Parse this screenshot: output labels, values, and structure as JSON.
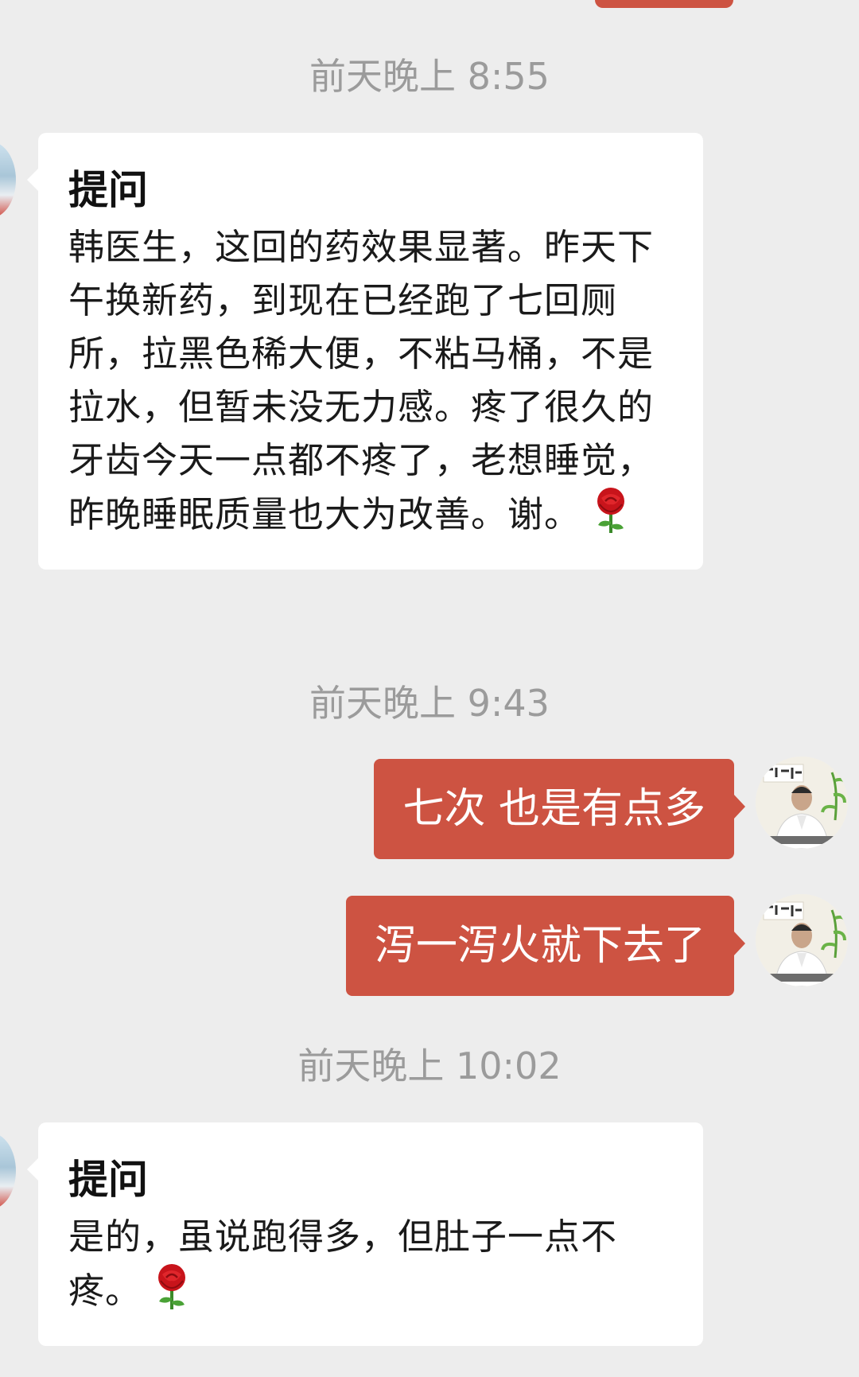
{
  "messages": {
    "ts1": "前天晚上 8:55",
    "msg1": {
      "title": "提问",
      "body": "韩医生，这回的药效果显著。昨天下午换新药，到现在已经跑了七回厕所，拉黑色稀大便，不粘马桶，不是拉水，但暂未没无力感。疼了很久的牙齿今天一点都不疼了，老想睡觉，昨晚睡眠质量也大为改善。谢。"
    },
    "ts2": "前天晚上 9:43",
    "reply1": "七次 也是有点多",
    "reply2": "泻一泻火就下去了",
    "ts3": "前天晚上 10:02",
    "msg2": {
      "title": "提问",
      "body": "是的，虽说跑得多，但肚子一点不疼。"
    }
  },
  "icons": {
    "emoji": "rose-emoji",
    "avatar_left": "user-avatar",
    "avatar_right": "doctor-avatar"
  },
  "colors": {
    "background": "#ededed",
    "outgoing_bubble": "#cd5342",
    "incoming_bubble": "#ffffff",
    "timestamp": "#9b9b9b"
  }
}
